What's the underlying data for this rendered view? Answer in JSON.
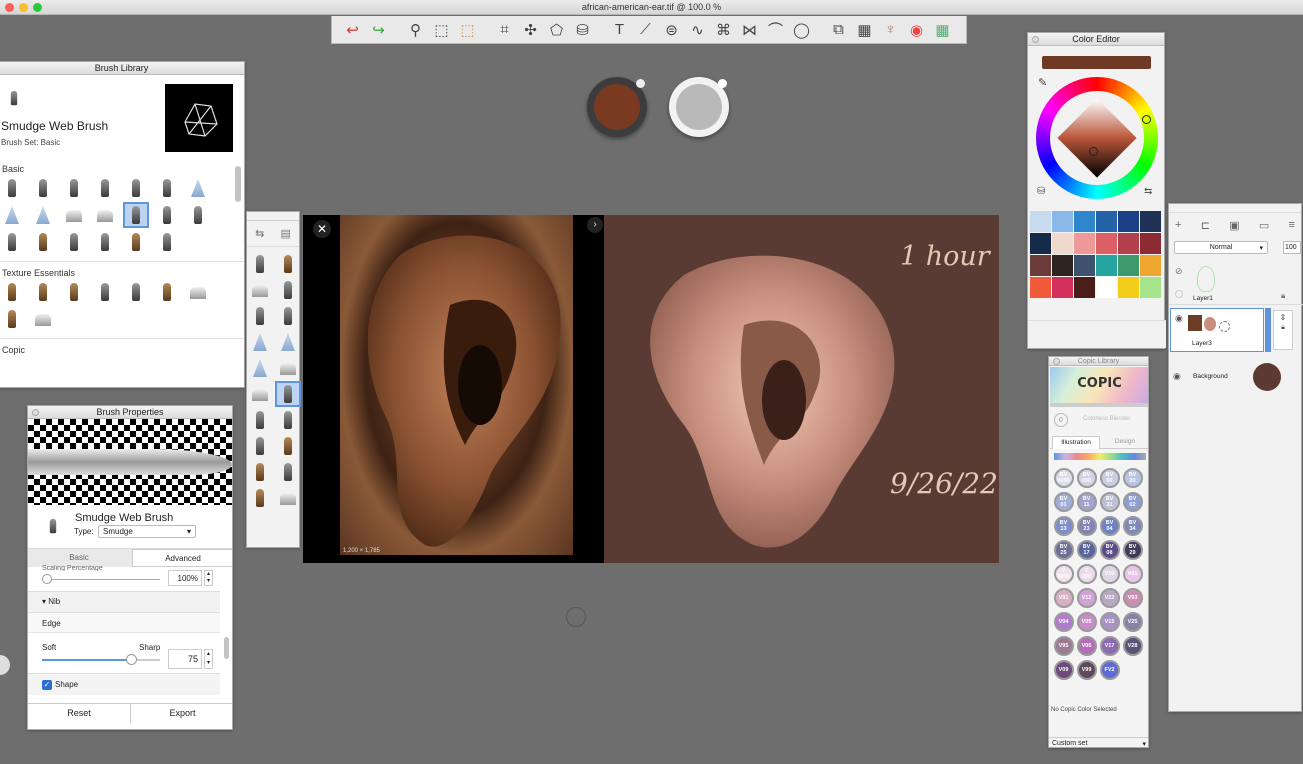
{
  "window": {
    "title": "african-american-ear.tif @ 100.0 %"
  },
  "toolbar": {
    "tools": [
      {
        "icon": "undo-icon",
        "glyph": "↩",
        "color": "#d23b2a"
      },
      {
        "icon": "redo-icon",
        "glyph": "↪",
        "color": "#38a83a"
      },
      {
        "icon": "zoom-icon",
        "glyph": "⚲",
        "color": "#444"
      },
      {
        "icon": "rect-select-icon",
        "glyph": "⬚",
        "color": "#444"
      },
      {
        "icon": "lasso-select-icon",
        "glyph": "⬚",
        "color": "#c84"
      },
      {
        "icon": "crop-icon",
        "glyph": "⌗",
        "color": "#444"
      },
      {
        "icon": "magic-wand-icon",
        "glyph": "✣",
        "color": "#444"
      },
      {
        "icon": "transform-icon",
        "glyph": "⬠",
        "color": "#444"
      },
      {
        "icon": "fill-icon",
        "glyph": "⛁",
        "color": "#444"
      },
      {
        "icon": "text-icon",
        "glyph": "T",
        "color": "#444"
      },
      {
        "icon": "ruler-icon",
        "glyph": "⟋",
        "color": "#444"
      },
      {
        "icon": "ellipse-guide-icon",
        "glyph": "⊜",
        "color": "#444"
      },
      {
        "icon": "french-curve-icon",
        "glyph": "∿",
        "color": "#444"
      },
      {
        "icon": "perspective-icon",
        "glyph": "⌘",
        "color": "#444"
      },
      {
        "icon": "symmetry-icon",
        "glyph": "⋈",
        "color": "#444"
      },
      {
        "icon": "stroke-icon",
        "glyph": "⌒",
        "color": "#444"
      },
      {
        "icon": "shape-icon",
        "glyph": "◯",
        "color": "#444"
      },
      {
        "icon": "layers-icon",
        "glyph": "⧉",
        "color": "#444"
      },
      {
        "icon": "texture-icon",
        "glyph": "▦",
        "color": "#444"
      },
      {
        "icon": "brushes-icon",
        "glyph": "♆",
        "color": "#a86"
      },
      {
        "icon": "color-wheel-icon",
        "glyph": "◉",
        "color": "#e44"
      },
      {
        "icon": "grid-icon",
        "glyph": "▦",
        "color": "#5a7"
      }
    ]
  },
  "colors": {
    "foreground": "#7a3a22",
    "background": "#b9b9b9",
    "editor_current": "#6e3a26",
    "canvas_paint_bg": "#5a3b33",
    "layer_background": "#5c3a33"
  },
  "brush_library": {
    "title": "Brush Library",
    "brush_name": "Smudge Web Brush",
    "brush_set": "Brush Set: Basic",
    "sections": [
      "Basic",
      "Texture Essentials",
      "Copic"
    ]
  },
  "brush_properties": {
    "title": "Brush Properties",
    "brush_name": "Smudge Web Brush",
    "type_label": "Type:",
    "type_value": "Smudge",
    "tabs": [
      "Basic",
      "Advanced"
    ],
    "scaling_label": "Scaling Percentage",
    "scaling_value": "100%",
    "nib_section": "▾ Nib",
    "edge_label": "Edge",
    "soft_label": "Soft",
    "sharp_label": "Sharp",
    "edge_value": "75",
    "edge_level": 0.75,
    "shape_label": "Shape",
    "reset": "Reset",
    "export": "Export"
  },
  "canvas": {
    "ref_dims": "1,200 × 1,785",
    "annotation_time": "1 hour",
    "annotation_date": "9/26/22"
  },
  "color_editor": {
    "title": "Color Editor",
    "swatches": [
      "#c7dbef",
      "#8ab8e8",
      "#2f86cc",
      "#2563a8",
      "#1c3f86",
      "#1e3256",
      "#162a4a",
      "#efd9cc",
      "#ee9a99",
      "#dd5f66",
      "#b0404c",
      "#8d2b35",
      "#6a3c3c",
      "#2e2420",
      "#3e5270",
      "#27a3a2",
      "#3c9a6c",
      "#f0a732",
      "#f05a3a",
      "#d2315c",
      "#4a1e18",
      "#ffffff",
      "#f4cd1a",
      "#a5e48a"
    ]
  },
  "copic_library": {
    "title": "Copic Library",
    "logo": "COPIC",
    "colorless_num": "0",
    "colorless_label": "Colorless Blender",
    "tabs": [
      "Illustration",
      "Design"
    ],
    "markers": [
      {
        "code": "BV\n0000",
        "color": "#dcdcea"
      },
      {
        "code": "BV\n000",
        "color": "#d3d3e6"
      },
      {
        "code": "BV\n00",
        "color": "#c7cde2"
      },
      {
        "code": "BV\n20",
        "color": "#b9c4e3"
      },
      {
        "code": "BV\n01",
        "color": "#a2aed8"
      },
      {
        "code": "BV\n11",
        "color": "#a3a3cb"
      },
      {
        "code": "BV\n31",
        "color": "#bebfd6"
      },
      {
        "code": "BV\n02",
        "color": "#8d9ed0"
      },
      {
        "code": "BV\n13",
        "color": "#7d8fca"
      },
      {
        "code": "BV\n23",
        "color": "#8583b4"
      },
      {
        "code": "BV\n04",
        "color": "#6d82c4"
      },
      {
        "code": "BV\n34",
        "color": "#7f8ab8"
      },
      {
        "code": "BV\n25",
        "color": "#6e6e98"
      },
      {
        "code": "BV\n17",
        "color": "#5963a0"
      },
      {
        "code": "BV\n08",
        "color": "#5b4c8c"
      },
      {
        "code": "BV\n29",
        "color": "#3e3c5a"
      },
      {
        "code": "V\n0000",
        "color": "#eee2ea"
      },
      {
        "code": "V\n000",
        "color": "#eadcea"
      },
      {
        "code": "V20",
        "color": "#e0d7e6"
      },
      {
        "code": "V01",
        "color": "#e8c7e6"
      },
      {
        "code": "V91",
        "color": "#d9b0c0"
      },
      {
        "code": "V12",
        "color": "#d0a2d6"
      },
      {
        "code": "V22",
        "color": "#b7a8c4"
      },
      {
        "code": "V93",
        "color": "#cc8fb4"
      },
      {
        "code": "V04",
        "color": "#b07ccd"
      },
      {
        "code": "V05",
        "color": "#c88cc8"
      },
      {
        "code": "V15",
        "color": "#a891c4"
      },
      {
        "code": "V25",
        "color": "#8a81a4"
      },
      {
        "code": "V95",
        "color": "#9c7a92"
      },
      {
        "code": "V06",
        "color": "#b46eb8"
      },
      {
        "code": "V17",
        "color": "#8c6ab2"
      },
      {
        "code": "V28",
        "color": "#5c5476"
      },
      {
        "code": "V09",
        "color": "#6e4c7a"
      },
      {
        "code": "V99",
        "color": "#5e4a58"
      },
      {
        "code": "FV2",
        "color": "#5f6ad8"
      }
    ],
    "status": "No Copic Color Selected",
    "custom_set": "Custom set"
  },
  "layers": {
    "blend_mode": "Normal",
    "opacity": "100",
    "items": [
      "Layer1",
      "Layer3",
      "Background"
    ]
  }
}
